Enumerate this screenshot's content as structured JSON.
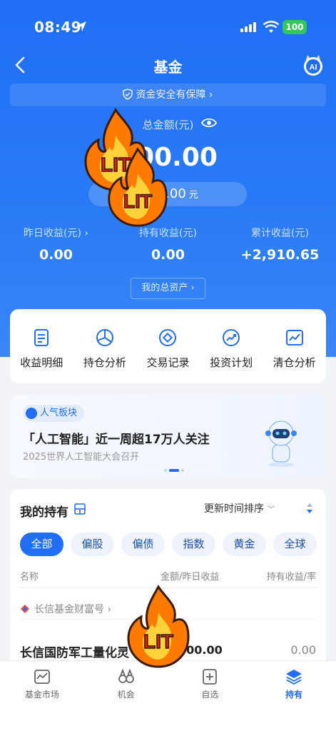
{
  "status_bar": {
    "time": "08:49",
    "battery": "100"
  },
  "nav": {
    "title": "基金",
    "ai_label": "AI"
  },
  "safety_banner": "资金安全有保障 ›",
  "summary": {
    "total_label": "总金额(元)",
    "total_amount": "000.00",
    "pill_amount": ",000.00",
    "pill_unit": "元",
    "stats": [
      {
        "label": "昨日收益(元) ›",
        "value": "0.00"
      },
      {
        "label": "持有收益(元)",
        "value": "0.00"
      },
      {
        "label": "累计收益(元)",
        "value": "+2,910.65"
      }
    ],
    "my_assets": "我的总资产 ›"
  },
  "quick_actions": [
    {
      "label": "收益明细",
      "icon": "receipt-icon"
    },
    {
      "label": "持仓分析",
      "icon": "pie-chart-icon"
    },
    {
      "label": "交易记录",
      "icon": "record-icon"
    },
    {
      "label": "投资计划",
      "icon": "plan-icon"
    },
    {
      "label": "清仓分析",
      "icon": "line-chart-icon"
    }
  ],
  "promo": {
    "badge": "人气板块",
    "title": "「人工智能」近一周超17万人关注",
    "subtitle": "2025世界人工智能大会召开"
  },
  "holdings": {
    "title": "我的持有",
    "sort": "更新时间排序",
    "chips": [
      "全部",
      "偏股",
      "偏债",
      "指数",
      "黄金",
      "全球"
    ],
    "columns": [
      "名称",
      "金额/昨日收益",
      "持有收益/率"
    ],
    "company": "长信基金财富号 ›",
    "fund": {
      "name": "长信国防军工量化灵",
      "amount": "000.00",
      "profit": "0.00"
    }
  },
  "tabs": [
    {
      "label": "基金市场",
      "icon": "market-icon"
    },
    {
      "label": "机会",
      "icon": "binoculars-icon"
    },
    {
      "label": "自选",
      "icon": "add-favorite-icon"
    },
    {
      "label": "持有",
      "icon": "holdings-icon",
      "active": true
    }
  ],
  "sticker_text": "LIT",
  "colors": {
    "primary": "#1f6ef5",
    "background": "#f2f3f7",
    "battery": "#34c759",
    "flame": "#ff7a00"
  }
}
